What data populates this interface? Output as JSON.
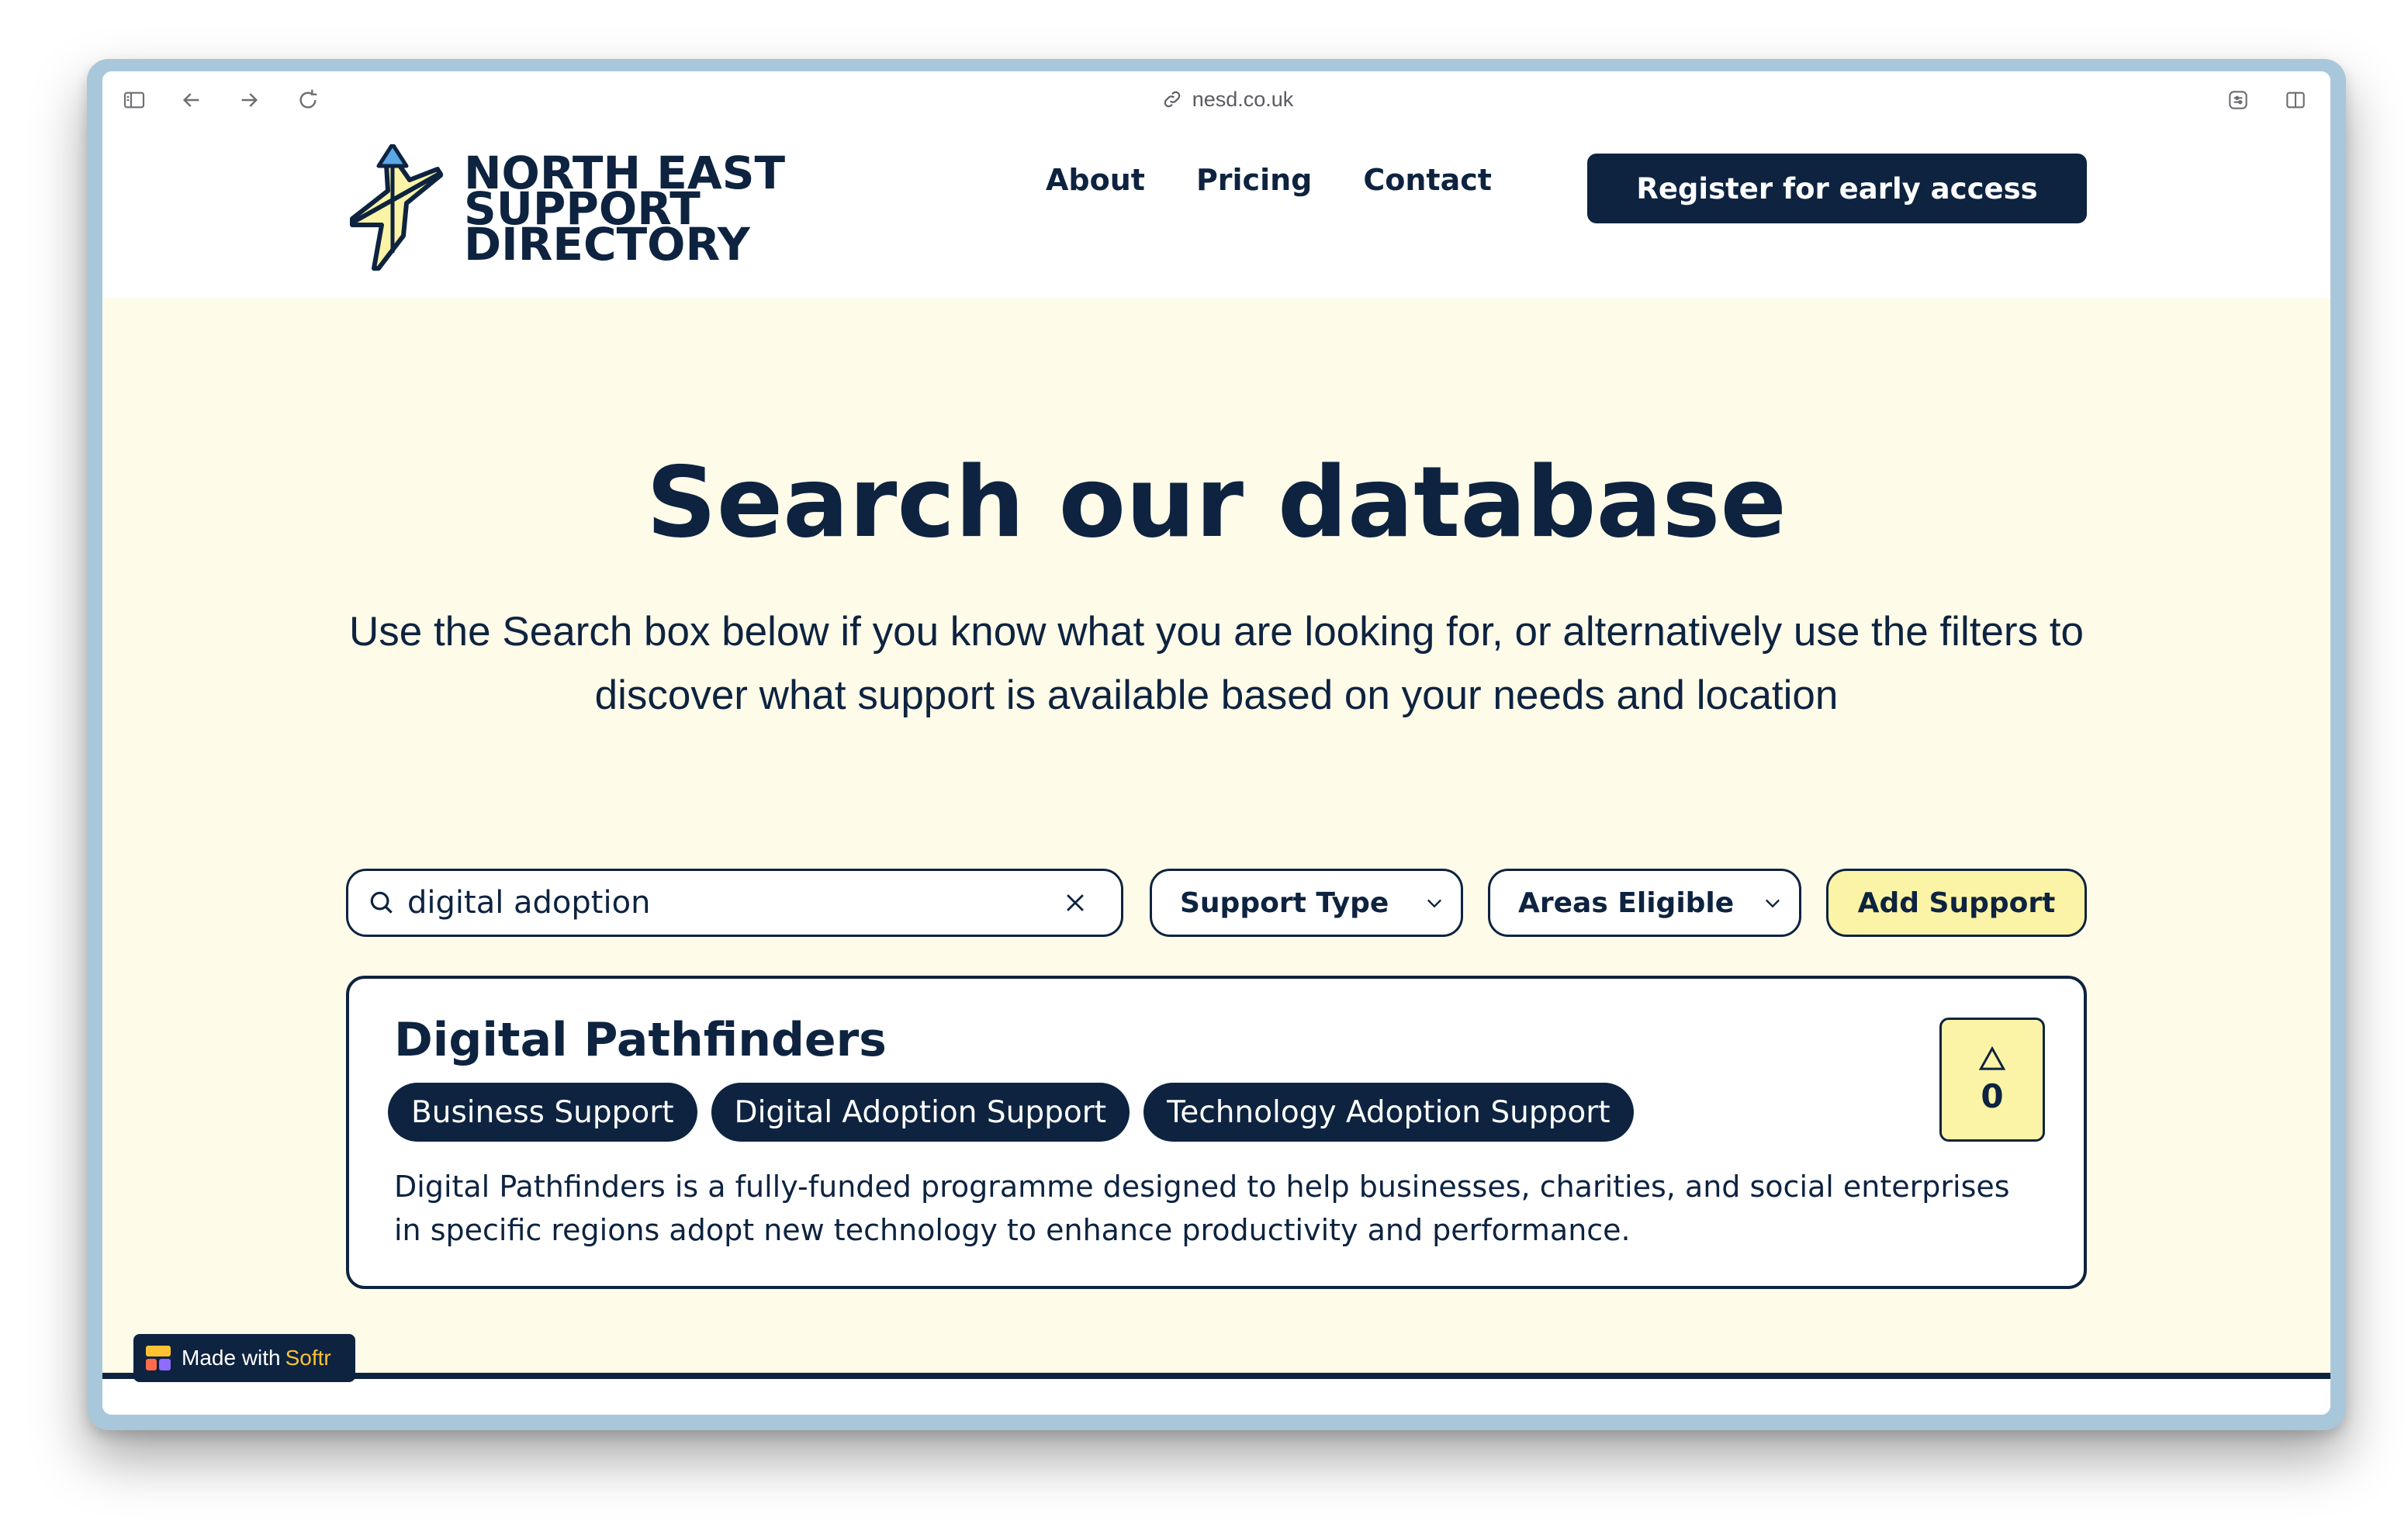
{
  "browser": {
    "url": "nesd.co.uk"
  },
  "header": {
    "logo_lines": [
      "NORTH EAST",
      "SUPPORT",
      "DIRECTORY"
    ],
    "nav": [
      "About",
      "Pricing",
      "Contact"
    ],
    "cta": "Register for early access"
  },
  "hero": {
    "title": "Search our database",
    "subtitle": "Use the Search box below if you know what you are looking for, or alternatively use the filters to discover what support is available based on your needs and location"
  },
  "filters": {
    "search_value": "digital adoption",
    "support_type": "Support Type",
    "areas_eligible": "Areas Eligible",
    "add_support": "Add Support"
  },
  "result": {
    "title": "Digital Pathfinders",
    "tags": [
      "Business Support",
      "Digital Adoption Support",
      "Technology Adoption Support"
    ],
    "description": "Digital Pathfinders is a fully-funded programme designed to help businesses, charities, and social enterprises in specific regions adopt new technology to enhance productivity and performance.",
    "votes": "0"
  },
  "badge": {
    "prefix": "Made with",
    "brand": "Softr"
  },
  "colors": {
    "navy": "#0d2340",
    "cream": "#fefbe8",
    "yellow": "#fbf3a6",
    "frame": "#a9c7db"
  }
}
